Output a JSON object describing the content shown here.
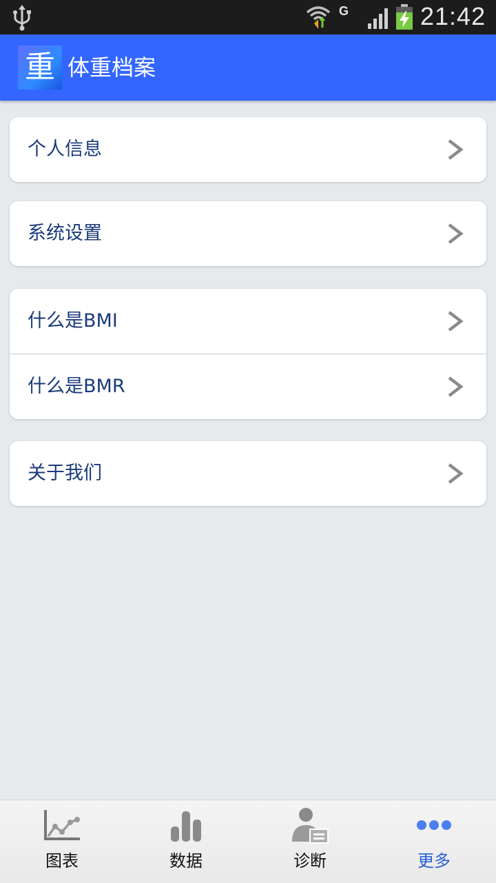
{
  "status_bar": {
    "network_type": "G",
    "time": "21:42"
  },
  "app_bar": {
    "logo_char": "重",
    "title": "体重档案"
  },
  "menu": {
    "personal_info": "个人信息",
    "system_settings": "系统设置",
    "what_is_bmi": "什么是BMI",
    "what_is_bmr": "什么是BMR",
    "about_us": "关于我们"
  },
  "bottom_nav": {
    "chart": "图表",
    "data": "数据",
    "diagnosis": "诊断",
    "more": "更多",
    "active": "more"
  },
  "colors": {
    "app_bar": "#3366ff",
    "menu_text": "#1a3a7a",
    "active_tab": "#2a5fd6",
    "background": "#e6eaed"
  }
}
